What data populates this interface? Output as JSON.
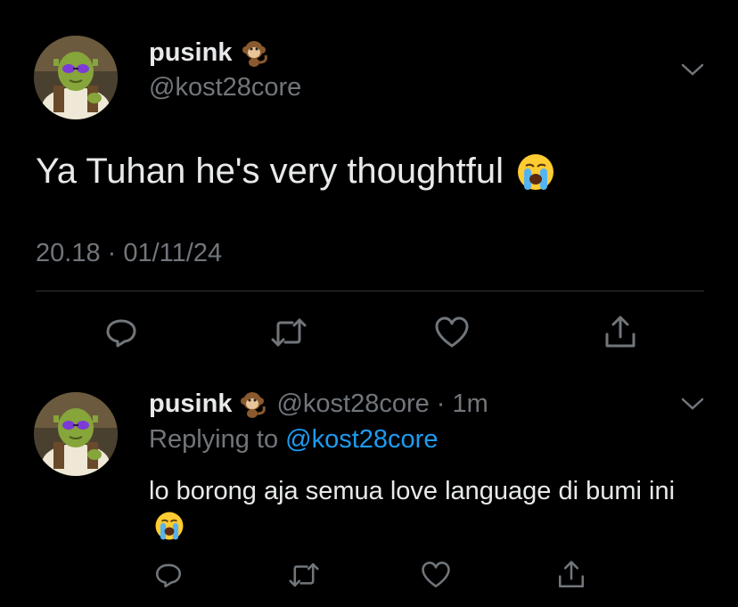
{
  "main_tweet": {
    "display_name": "pusink",
    "name_emoji": "monkey-emoji",
    "handle": "@kost28core",
    "text": "Ya Tuhan he's very thoughtful",
    "text_emoji": "loudly-crying-face-emoji",
    "timestamp": "20.18 · 01/11/24",
    "actions": [
      "reply-icon",
      "retweet-icon",
      "like-icon",
      "share-icon"
    ]
  },
  "reply_tweet": {
    "display_name": "pusink",
    "name_emoji": "monkey-emoji",
    "handle": "@kost28core",
    "separator": "·",
    "time": "1m",
    "replying_prefix": "Replying to",
    "replying_mention": "@kost28core",
    "text": "lo borong aja semua love language di bumi ini",
    "text_emoji": "loudly-crying-face-emoji",
    "actions": [
      "reply-icon",
      "retweet-icon",
      "like-icon",
      "share-icon"
    ]
  },
  "colors": {
    "background": "#000000",
    "primary_text": "#e7e9ea",
    "secondary_text": "#71767b",
    "link": "#1d9bf0",
    "divider": "#2f3336"
  }
}
